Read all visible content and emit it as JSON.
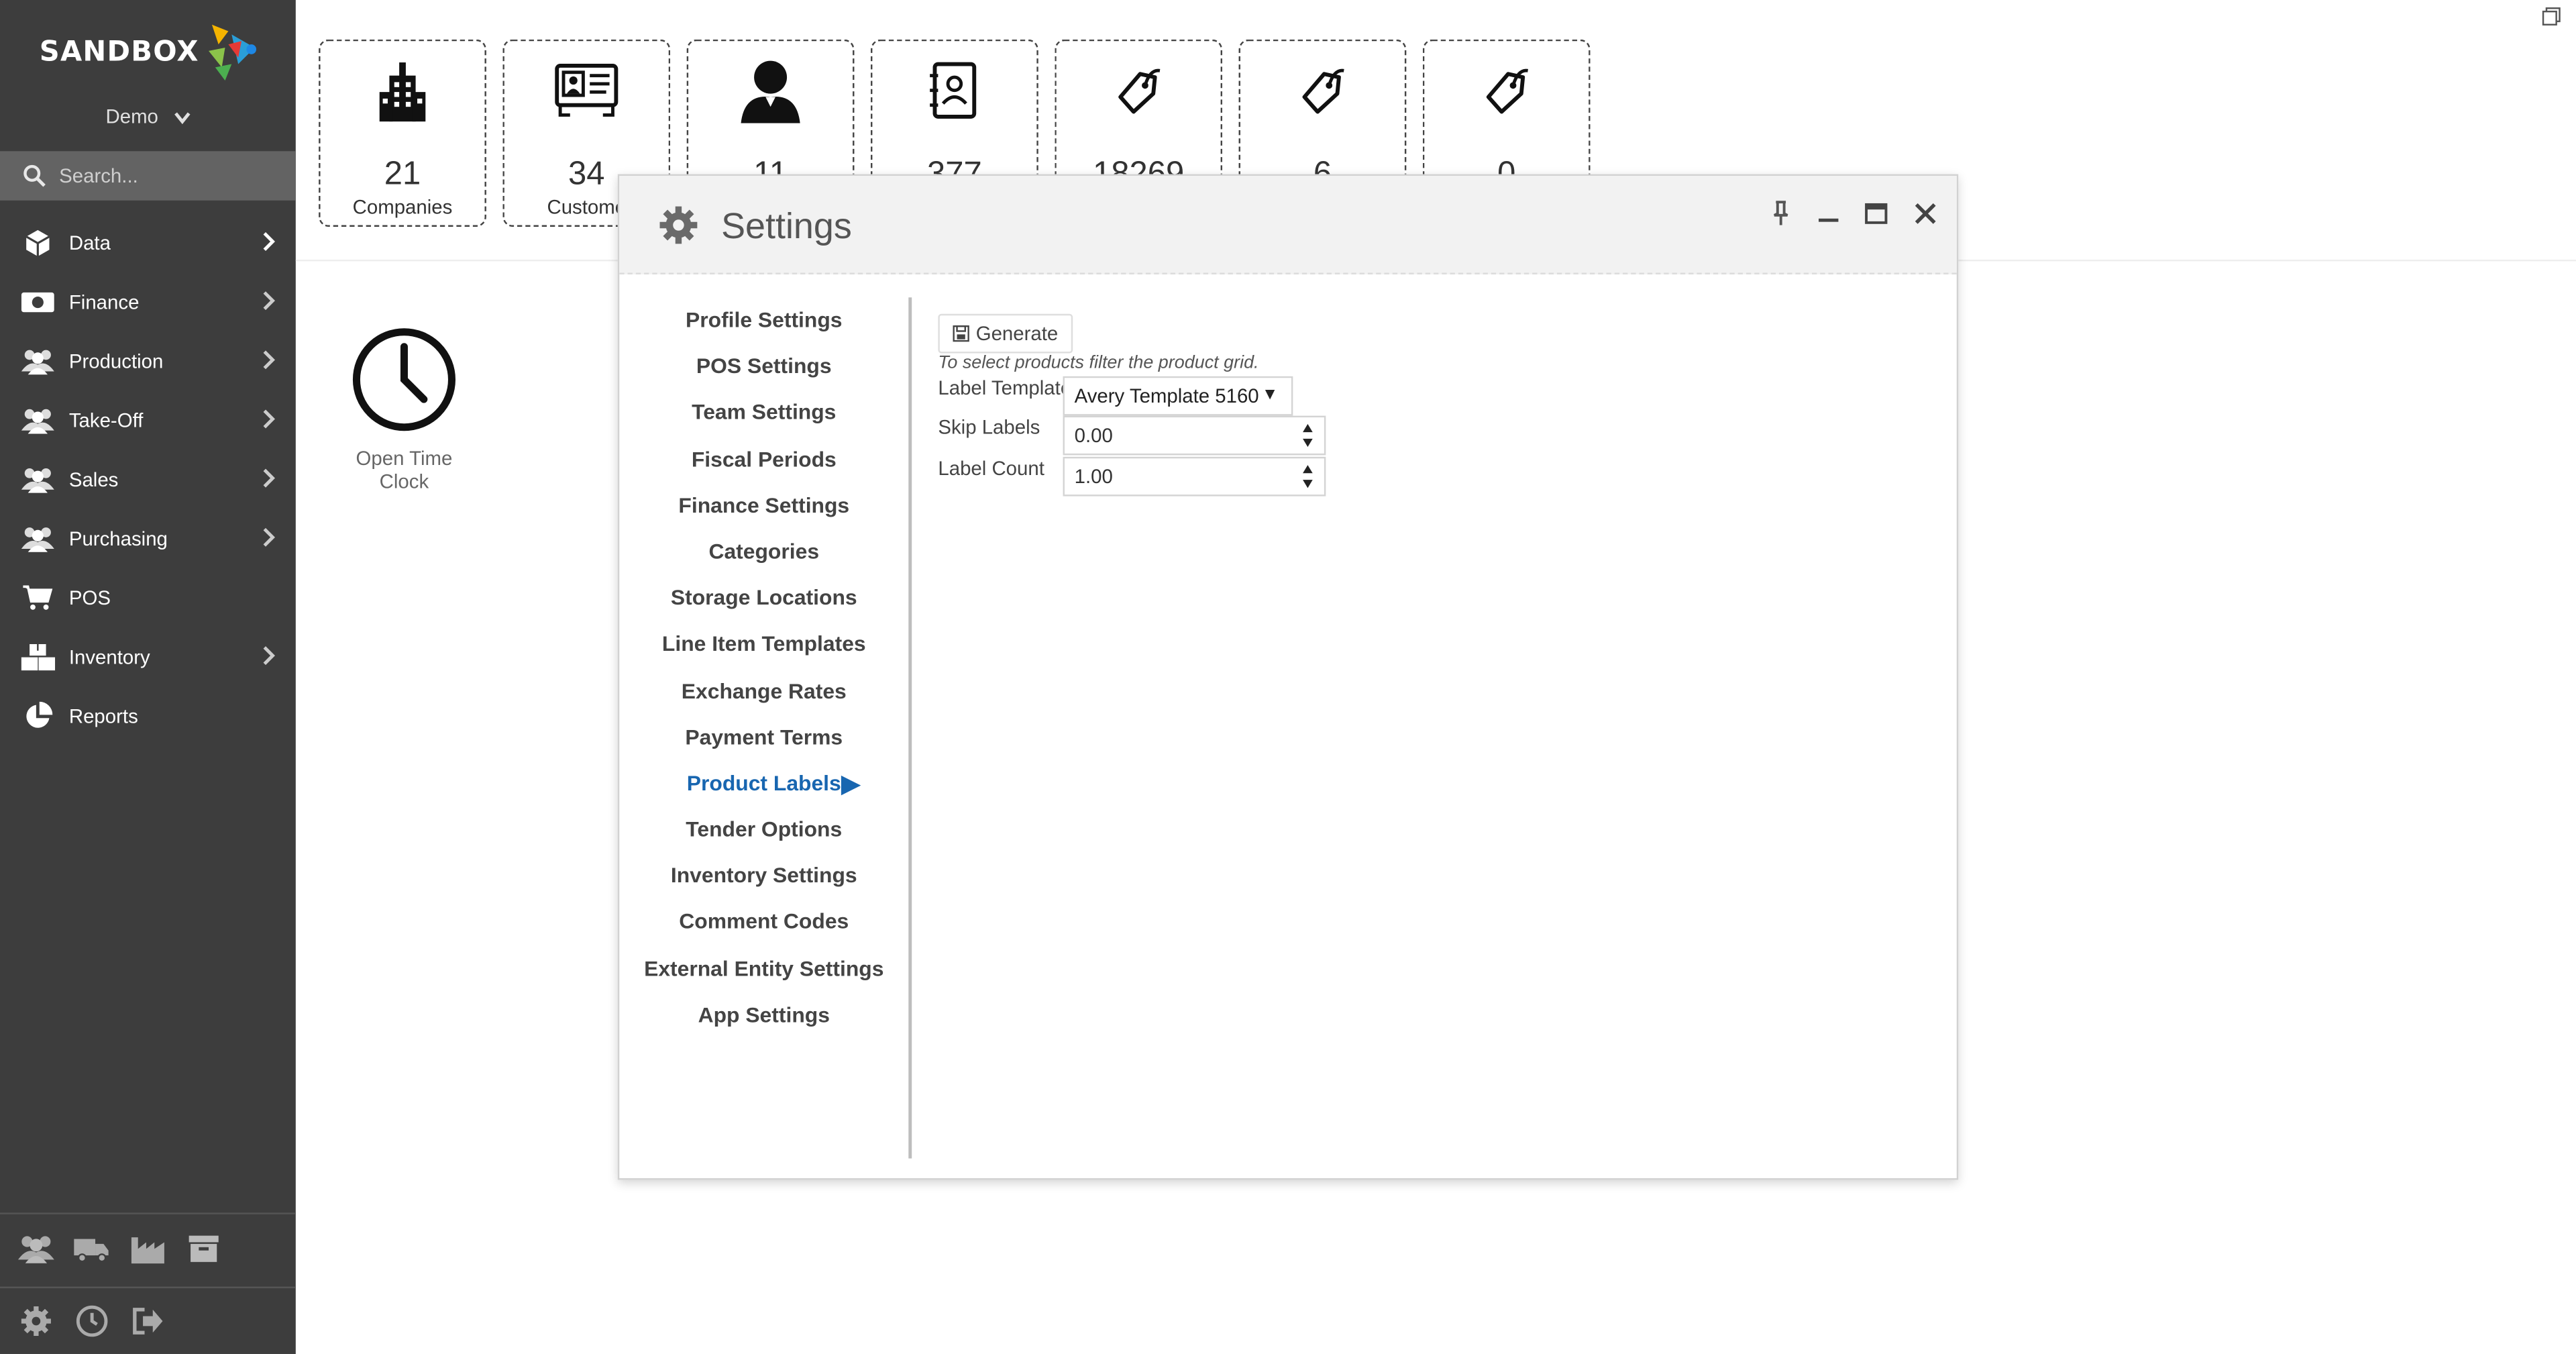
{
  "sidebar": {
    "brand": "SANDBOX",
    "environment": "Demo",
    "search_placeholder": "Search...",
    "items": [
      {
        "label": "Data",
        "icon": "cube-icon",
        "has_arrow": true
      },
      {
        "label": "Finance",
        "icon": "money-icon",
        "has_arrow": true
      },
      {
        "label": "Production",
        "icon": "users-icon",
        "has_arrow": true
      },
      {
        "label": "Take-Off",
        "icon": "users-icon",
        "has_arrow": true
      },
      {
        "label": "Sales",
        "icon": "users-icon",
        "has_arrow": true
      },
      {
        "label": "Purchasing",
        "icon": "users-icon",
        "has_arrow": true
      },
      {
        "label": "POS",
        "icon": "cart-icon",
        "has_arrow": false
      },
      {
        "label": "Inventory",
        "icon": "boxes-icon",
        "has_arrow": true
      },
      {
        "label": "Reports",
        "icon": "pie-chart-icon",
        "has_arrow": false
      }
    ],
    "bottom_icons": [
      "users-icon",
      "truck-icon",
      "factory-icon",
      "archive-icon",
      "gear-icon",
      "clock-icon",
      "logout-icon"
    ]
  },
  "tiles": [
    {
      "value": "21",
      "label": "Companies",
      "icon": "building-icon"
    },
    {
      "value": "34",
      "label": "Custome",
      "icon": "contact-card-icon"
    },
    {
      "value": "11",
      "label": "",
      "icon": "user-icon"
    },
    {
      "value": "377",
      "label": "",
      "icon": "address-book-icon"
    },
    {
      "value": "18269",
      "label": "",
      "icon": "tag-icon"
    },
    {
      "value": "6",
      "label": "",
      "icon": "tag-icon"
    },
    {
      "value": "0",
      "label": "",
      "icon": "tag-icon"
    }
  ],
  "time_clock": {
    "label": "Open Time Clock",
    "icon": "clock-icon"
  },
  "dialog": {
    "title": "Settings",
    "menu": [
      "Profile Settings",
      "POS Settings",
      "Team Settings",
      "Fiscal Periods",
      "Finance Settings",
      "Categories",
      "Storage Locations",
      "Line Item Templates",
      "Exchange Rates",
      "Payment Terms",
      "Product Labels",
      "Tender Options",
      "Inventory Settings",
      "Comment Codes",
      "External Entity Settings",
      "App Settings"
    ],
    "active_index": 10,
    "generate_label": "Generate",
    "hint": "To select products filter the product grid.",
    "fields": {
      "label_template": {
        "label": "Label Template",
        "value": "Avery Template 5160"
      },
      "skip_labels": {
        "label": "Skip Labels",
        "value": "0.00"
      },
      "label_count": {
        "label": "Label Count",
        "value": "1.00"
      }
    }
  },
  "colors": {
    "sidebar": "#3d3d3d",
    "accent": "#1866b0",
    "search": "#636363"
  }
}
